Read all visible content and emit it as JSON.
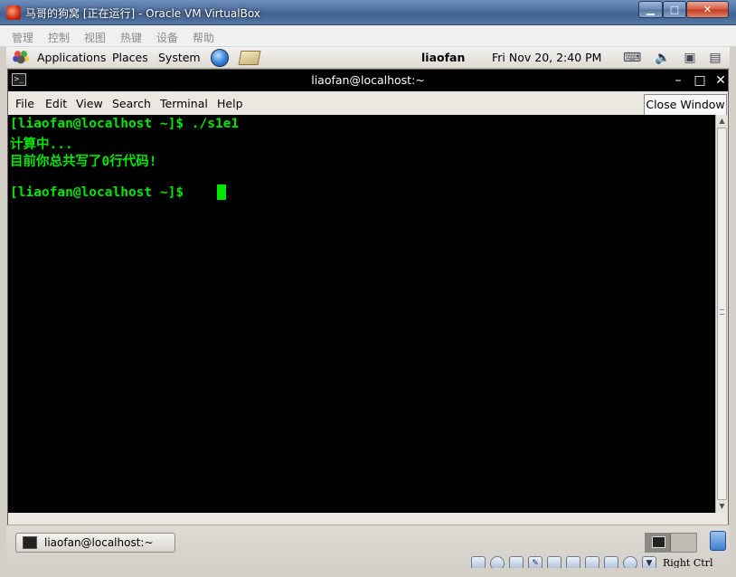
{
  "host_window": {
    "title": "马哥的狗窝 [正在运行] - Oracle VM VirtualBox",
    "controls": {
      "minimize": "▁",
      "maximize": "□",
      "close": "✕"
    }
  },
  "vbox_menu": [
    "管理",
    "控制",
    "视图",
    "热键",
    "设备",
    "帮助"
  ],
  "gnome_panel": {
    "menus": [
      "Applications",
      "Places",
      "System"
    ],
    "user": "liaofan",
    "clock": "Fri Nov 20,  2:40 PM",
    "icons": [
      "gnome-foot-icon",
      "browser-icon",
      "mail-icon",
      "network-icon",
      "volume-icon",
      "network-disconnected-icon",
      "clipboard-icon"
    ]
  },
  "terminal": {
    "title": "liaofan@localhost:~",
    "title_controls": {
      "minimize": "–",
      "maximize": "□",
      "close": "✕"
    },
    "menus": [
      "File",
      "Edit",
      "View",
      "Search",
      "Terminal",
      "Help"
    ],
    "tooltip": "Close Window",
    "lines": [
      "[liaofan@localhost ~]$ ./s1e1",
      "计算中...",
      "目前你总共写了0行代码!",
      "",
      "[liaofan@localhost ~]$ "
    ],
    "text_color": "#00e600",
    "background": "#000000"
  },
  "bottom_panel": {
    "task": "liaofan@localhost:~"
  },
  "vbox_status": {
    "host_key": "Right Ctrl",
    "icons": [
      "hard-disk-icon",
      "optical-disk-icon",
      "usb-icon",
      "pencil-icon",
      "shared-folder-icon",
      "display-icon",
      "network-adapter-icon",
      "capture-icon",
      "mouse-integration-icon",
      "arrow-down-icon"
    ]
  }
}
